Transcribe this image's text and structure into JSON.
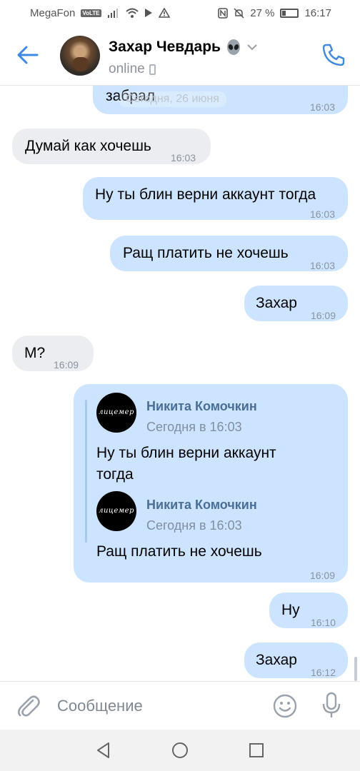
{
  "status_bar": {
    "carrier": "MegaFon",
    "volte": "VoLTE",
    "battery_text": "27 %",
    "battery_level": 0.27,
    "time": "16:17"
  },
  "header": {
    "contact_name": "Захар Чевдарь",
    "status": "online",
    "icons": [
      "back-arrow-icon",
      "alien-emoji-icon",
      "chevron-down-icon",
      "phone-icon"
    ]
  },
  "chat": {
    "date_pill": "Сегодня, 26 июня",
    "messages": [
      {
        "dir": "out",
        "text": "забрал",
        "time": "16:03"
      },
      {
        "dir": "in",
        "text": "Думай как хочешь",
        "time": "16:03"
      },
      {
        "dir": "out",
        "text": "Ну ты блин верни аккаунт тогда",
        "time": "16:03"
      },
      {
        "dir": "out",
        "text": "Ращ платить не хочешь",
        "time": "16:03"
      },
      {
        "dir": "out",
        "text": "Захар",
        "time": "16:09"
      },
      {
        "dir": "in",
        "text": "М?",
        "time": "16:09"
      },
      {
        "dir": "out",
        "time": "16:09",
        "forwarded": [
          {
            "author": "Никита Комочкин",
            "date": "Сегодня в 16:03",
            "avatar_text": "лицемер",
            "text_line1": "Ну ты блин верни аккаунт",
            "text_line2": "тогда"
          },
          {
            "author": "Никита Комочкин",
            "date": "Сегодня в 16:03",
            "avatar_text": "лицемер",
            "text": "Ращ платить не хочешь"
          }
        ]
      },
      {
        "dir": "out",
        "text": "Ну",
        "time": "16:10"
      },
      {
        "dir": "out",
        "text": "Захар",
        "time": "16:12"
      }
    ]
  },
  "input": {
    "placeholder": "Сообщение",
    "icons": [
      "paperclip-icon",
      "smile-icon",
      "microphone-icon"
    ]
  },
  "nav": {
    "icons": [
      "nav-back-icon",
      "nav-home-icon",
      "nav-recents-icon"
    ]
  },
  "colors": {
    "accent": "#3f8ae0",
    "outgoing_bubble": "#cce4ff",
    "incoming_bubble": "#ebedf0"
  }
}
